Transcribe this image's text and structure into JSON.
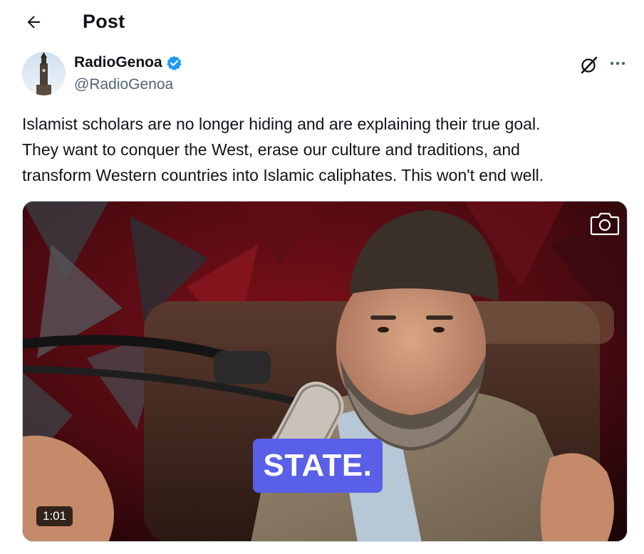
{
  "header": {
    "back_icon": "arrow-left-icon",
    "title": "Post"
  },
  "post": {
    "author": {
      "name": "RadioGenoa",
      "handle": "@RadioGenoa",
      "verified": true,
      "verified_color": "#1d9bf0"
    },
    "actions": {
      "grok_icon": "grok-icon",
      "more_icon": "more-horizontal-icon"
    },
    "text": "Islamist scholars are no longer hiding and are explaining their true goal.\nThey want to conquer the West, erase our culture and traditions, and\ntransform Western countries into Islamic caliphates. This won't end well.",
    "media": {
      "type": "video",
      "caption": "STATE.",
      "caption_bg": "#5a5fe8",
      "duration": "1:01",
      "camera_icon": "camera-icon"
    }
  }
}
